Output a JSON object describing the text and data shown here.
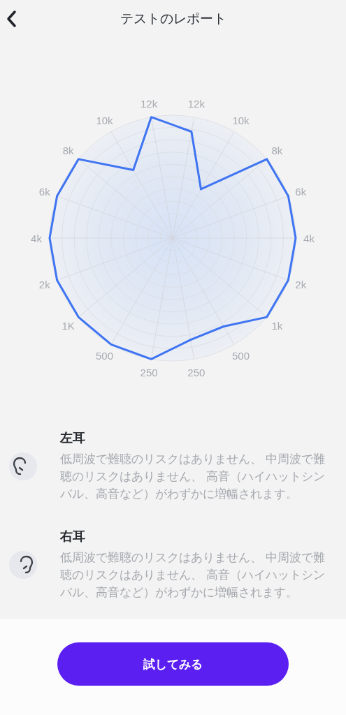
{
  "header": {
    "title": "テストのレポート"
  },
  "chart": {
    "axis_labels": [
      "12k",
      "10k",
      "8k",
      "6k",
      "4k",
      "2k",
      "1k",
      "500",
      "250",
      "250",
      "500",
      "1K",
      "2k",
      "4k",
      "6k",
      "8k",
      "10k",
      "12k"
    ]
  },
  "ears": [
    {
      "kind": "left",
      "title": "左耳",
      "description": "低周波で難聴のリスクはありません、 中周波で難聴のリスクはありません、 高音（ハイハットシンバル、高音など）がわずかに増幅されます。"
    },
    {
      "kind": "right",
      "title": "右耳",
      "description": "低周波で難聴のリスクはありません、 中周波で難聴のリスクはありません、 高音（ハイハットシンバル、高音など）がわずかに増幅されます。"
    }
  ],
  "button": {
    "label": "試してみる"
  }
}
